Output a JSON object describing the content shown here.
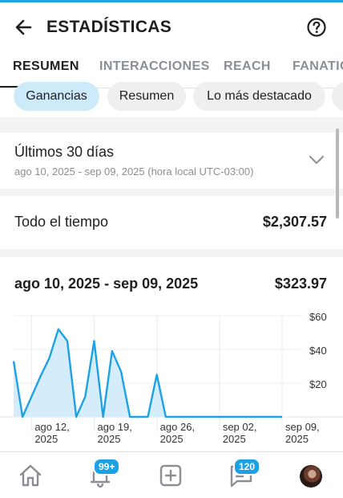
{
  "header": {
    "title": "ESTADÍSTICAS"
  },
  "tabs": [
    {
      "label": "RESUMEN",
      "active": true
    },
    {
      "label": "INTERACCIONES",
      "active": false
    },
    {
      "label": "REACH",
      "active": false
    },
    {
      "label": "FANATIC",
      "active": false
    }
  ],
  "chips": [
    {
      "label": "Ganancias",
      "active": true
    },
    {
      "label": "Resumen",
      "active": false
    },
    {
      "label": "Lo más destacado",
      "active": false
    }
  ],
  "period": {
    "title": "Últimos 30 días",
    "subtitle": "ago 10, 2025 - sep 09, 2025 (hora local UTC-03:00)"
  },
  "all_time": {
    "label": "Todo el tiempo",
    "value": "$2,307.57"
  },
  "range": {
    "label": "ago 10, 2025 - sep 09, 2025",
    "value": "$323.97"
  },
  "chart_data": {
    "type": "area",
    "x": [
      "2025-08-10",
      "2025-08-11",
      "2025-08-12",
      "2025-08-13",
      "2025-08-14",
      "2025-08-15",
      "2025-08-16",
      "2025-08-17",
      "2025-08-18",
      "2025-08-19",
      "2025-08-20",
      "2025-08-21",
      "2025-08-22",
      "2025-08-23",
      "2025-08-24",
      "2025-08-25",
      "2025-08-26",
      "2025-08-27",
      "2025-08-28",
      "2025-08-29",
      "2025-08-30",
      "2025-08-31",
      "2025-09-01",
      "2025-09-02",
      "2025-09-03",
      "2025-09-04",
      "2025-09-05",
      "2025-09-06",
      "2025-09-07",
      "2025-09-08",
      "2025-09-09"
    ],
    "y": [
      33,
      0,
      12,
      24,
      35,
      52,
      45,
      0,
      12,
      45,
      0,
      39,
      27,
      0,
      0,
      0,
      25,
      0,
      0,
      0,
      0,
      0,
      0,
      0,
      0,
      0,
      0,
      0,
      0,
      0,
      0
    ],
    "ylim": [
      0,
      60
    ],
    "y_ticks": [
      "$60",
      "$40",
      "$20"
    ],
    "x_ticks": [
      {
        "line1": "ago 12,",
        "line2": "2025"
      },
      {
        "line1": "ago 19,",
        "line2": "2025"
      },
      {
        "line1": "ago 26,",
        "line2": "2025"
      },
      {
        "line1": "sep 02,",
        "line2": "2025"
      },
      {
        "line1": "sep 09,",
        "line2": "2025"
      }
    ],
    "grid": true,
    "color": "#1da1e6"
  },
  "bottom_nav": {
    "items": [
      {
        "icon": "home-icon"
      },
      {
        "icon": "notifications-icon",
        "badge": "99+"
      },
      {
        "icon": "add-post-icon"
      },
      {
        "icon": "messages-icon",
        "badge": "120"
      },
      {
        "icon": "avatar"
      }
    ]
  },
  "colors": {
    "accent": "#1da1e6",
    "chip_active": "#cdeafb"
  }
}
